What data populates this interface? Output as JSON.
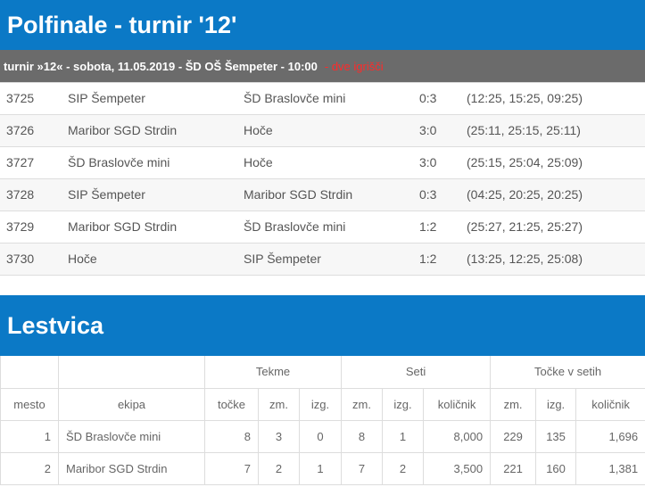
{
  "section_title": "Polfinale - turnir '12'",
  "tournament_bar": {
    "text": "turnir »12« - sobota, 11.05.2019 - ŠD OŠ Šempeter - 10:00",
    "note": "- dve igrišči"
  },
  "matches": [
    {
      "id": "3725",
      "home": "SIP Šempeter",
      "away": "ŠD Braslovče mini",
      "score": "0:3",
      "sets": "(12:25, 15:25, 09:25)"
    },
    {
      "id": "3726",
      "home": "Maribor SGD Strdin",
      "away": "Hoče",
      "score": "3:0",
      "sets": "(25:11, 25:15, 25:11)"
    },
    {
      "id": "3727",
      "home": "ŠD Braslovče mini",
      "away": "Hoče",
      "score": "3:0",
      "sets": "(25:15, 25:04, 25:09)"
    },
    {
      "id": "3728",
      "home": "SIP Šempeter",
      "away": "Maribor SGD Strdin",
      "score": "0:3",
      "sets": "(04:25, 20:25, 20:25)"
    },
    {
      "id": "3729",
      "home": "Maribor SGD Strdin",
      "away": "ŠD Braslovče mini",
      "score": "1:2",
      "sets": "(25:27, 21:25, 25:27)"
    },
    {
      "id": "3730",
      "home": "Hoče",
      "away": "SIP Šempeter",
      "score": "1:2",
      "sets": "(13:25, 12:25, 25:08)"
    }
  ],
  "standings": {
    "title": "Lestvica",
    "group_headers": {
      "tekme": "Tekme",
      "seti": "Seti",
      "tocke_v_setih": "Točke v setih"
    },
    "column_headers": {
      "mesto": "mesto",
      "ekipa": "ekipa",
      "tocke": "točke",
      "zm": "zm.",
      "izg": "izg.",
      "seti_zm": "zm.",
      "seti_izg": "izg.",
      "seti_kolicnik": "količnik",
      "pts_zm": "zm.",
      "pts_izg": "izg.",
      "pts_kolicnik": "količnik"
    },
    "rows": [
      {
        "mesto": "1",
        "ekipa": "ŠD Braslovče mini",
        "tocke": "8",
        "zm": "3",
        "izg": "0",
        "seti_zm": "8",
        "seti_izg": "1",
        "seti_kolicnik": "8,000",
        "pts_zm": "229",
        "pts_izg": "135",
        "pts_kolicnik": "1,696"
      },
      {
        "mesto": "2",
        "ekipa": "Maribor SGD Strdin",
        "tocke": "7",
        "zm": "2",
        "izg": "1",
        "seti_zm": "7",
        "seti_izg": "2",
        "seti_kolicnik": "3,500",
        "pts_zm": "221",
        "pts_izg": "160",
        "pts_kolicnik": "1,381"
      }
    ]
  }
}
